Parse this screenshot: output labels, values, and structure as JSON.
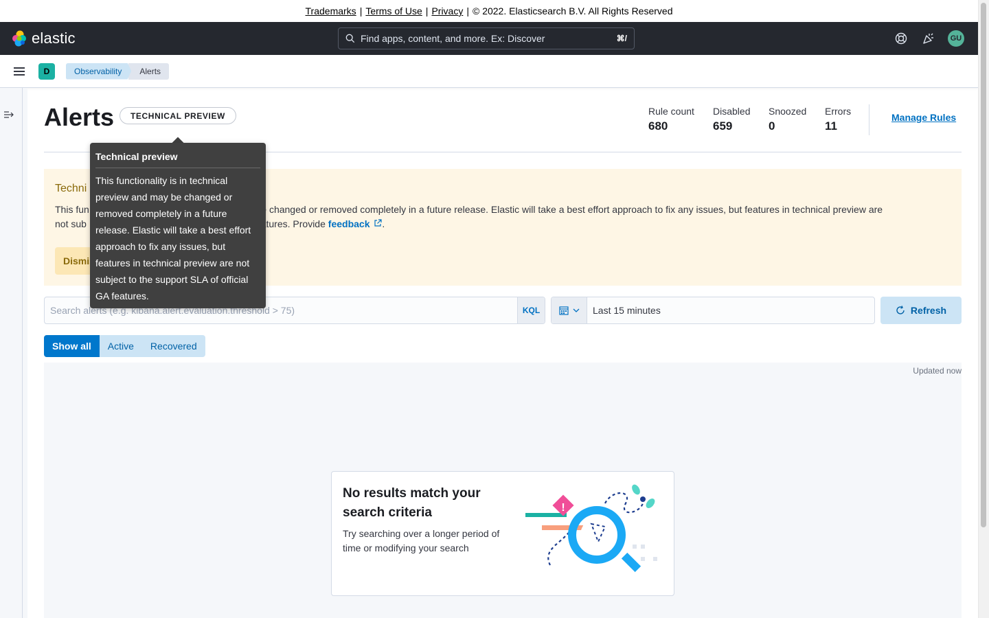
{
  "legal": {
    "trademarks": "Trademarks",
    "terms": "Terms of Use",
    "privacy": "Privacy",
    "sep": "|",
    "copyright": "© 2022. Elasticsearch B.V. All Rights Reserved"
  },
  "header": {
    "brand": "elastic",
    "search_placeholder": "Find apps, content, and more. Ex: Discover",
    "search_shortcut": "⌘/",
    "avatar_initials": "GU"
  },
  "breadcrumbs": {
    "space_initial": "D",
    "items": [
      {
        "label": "Observability"
      },
      {
        "label": "Alerts"
      }
    ]
  },
  "page": {
    "title": "Alerts",
    "badge": "TECHNICAL PREVIEW",
    "stats": [
      {
        "label": "Rule count",
        "value": "680"
      },
      {
        "label": "Disabled",
        "value": "659"
      },
      {
        "label": "Snoozed",
        "value": "0"
      },
      {
        "label": "Errors",
        "value": "11"
      }
    ],
    "manage_rules": "Manage Rules"
  },
  "callout": {
    "title": "Techni",
    "body_start": "This fun",
    "body_mid": "ay be changed or removed completely in a future release. Elastic will take a best effort approach to fix any issues, but features in technical preview are",
    "body_line2_start": "not sub",
    "body_line2_mid": "eatures. Provide",
    "feedback_link": "feedback",
    "body_end": ".",
    "dismiss": "Dismis"
  },
  "tooltip": {
    "title": "Technical preview",
    "body": "This functionality is in technical preview and may be changed or removed completely in a future release. Elastic will take a best effort approach to fix any issues, but features in technical preview are not subject to the support SLA of official GA features."
  },
  "search": {
    "placeholder": "Search alerts (e.g. kibana.alert.evaluation.threshold > 75)",
    "kql": "KQL"
  },
  "date": {
    "range": "Last 15 minutes"
  },
  "refresh": "Refresh",
  "filters": {
    "show_all": "Show all",
    "active": "Active",
    "recovered": "Recovered"
  },
  "results": {
    "updated": "Updated now",
    "empty_title": "No results match your search criteria",
    "empty_body": "Try searching over a longer period of time or modifying your search"
  },
  "colors": {
    "header_bg": "#25282f",
    "accent": "#0077cc",
    "callout_bg": "#fef6e5",
    "tooltip_bg": "#404040"
  }
}
